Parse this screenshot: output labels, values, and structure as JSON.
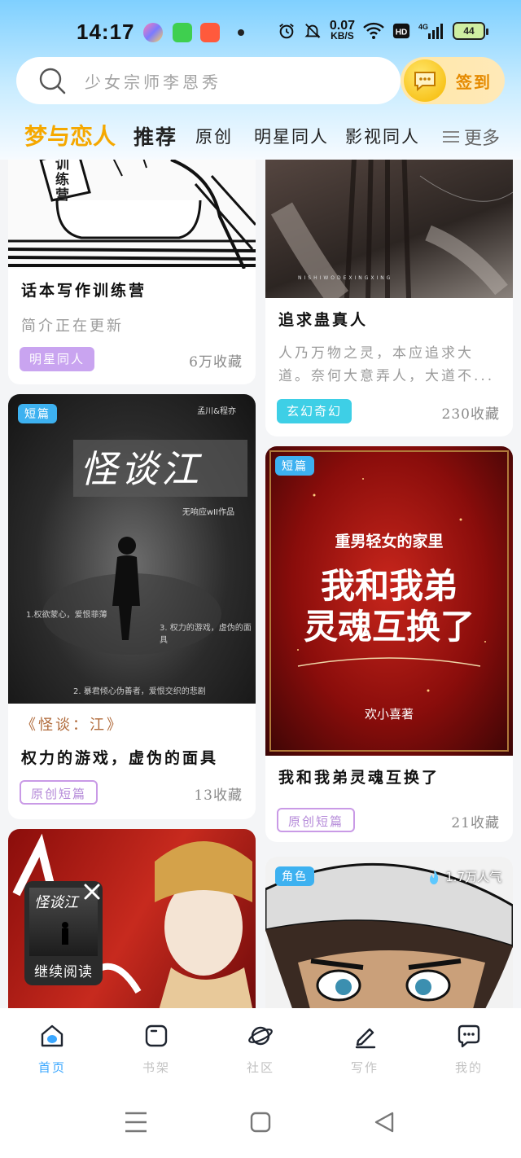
{
  "status": {
    "time": "14:17",
    "net_speed": "0.07",
    "net_unit": "KB/S",
    "battery": "44"
  },
  "search": {
    "placeholder": "少女宗师李恩秀"
  },
  "signin": {
    "label": "签到"
  },
  "tabs": {
    "brand": "梦与恋人",
    "items": [
      "推荐",
      "原创",
      "明星同人",
      "影视同人"
    ],
    "more": "更多"
  },
  "cards": [
    {
      "title": "话本写作训练营",
      "subtitle": "简介正在更新",
      "tag": "明星同人",
      "favorites": "6万收藏",
      "cover_text": "训练营"
    },
    {
      "title": "追求蛊真人",
      "desc": "人乃万物之灵，本应追求大道。奈何大意弄人，大道不...",
      "tag": "玄幻奇幻",
      "favorites": "230收藏",
      "cover_text": "NISHIWODEXINGXING"
    },
    {
      "badge": "短篇",
      "cover_title": "怪谈江",
      "cover_author": "孟川&程亦",
      "cover_credit": "无响应wII作品",
      "cover_line1": "1.权欲蒙心，爱恨菲薄",
      "cover_line2": "3. 权力的游戏，虚伪的面具",
      "cover_line3": "2. 暴君倾心伪善者，爱恨交织的悲剧",
      "subtitle": "《怪谈：江》",
      "title": "权力的游戏，虚伪的面具",
      "tag": "原创短篇",
      "favorites": "13收藏"
    },
    {
      "badge": "短篇",
      "cover_top": "重男轻女的家里",
      "cover_main1": "我和我弟",
      "cover_main2": "灵魂互换了",
      "cover_author": "欢小喜著",
      "title": "我和我弟灵魂互换了",
      "tag": "原创短篇",
      "favorites": "21收藏"
    },
    {
      "badge": "角色",
      "popularity": "1.7万人气"
    }
  ],
  "continue_reading": {
    "label": "继续阅读",
    "cover_title": "怪谈江"
  },
  "bottom_nav": [
    {
      "label": "首页"
    },
    {
      "label": "书架"
    },
    {
      "label": "社区"
    },
    {
      "label": "写作"
    },
    {
      "label": "我的"
    }
  ],
  "colors": {
    "accent": "#3aa7ff",
    "brand": "#f5a800",
    "tag_purple_bg": "#c9a4f0",
    "tag_cyan_bg": "#3ecfe6",
    "tag_outline": "#c99ae6"
  }
}
